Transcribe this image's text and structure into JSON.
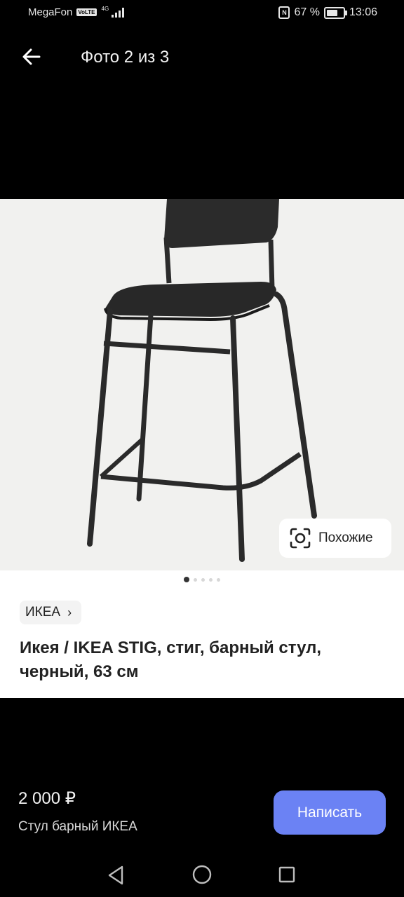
{
  "status_bar": {
    "carrier": "MegaFon",
    "volte": "VoLTE",
    "network": "4G",
    "battery_percent": "67 %",
    "time": "13:06",
    "battery_level": 0.67
  },
  "header": {
    "photo_counter": "Фото 2 из 3",
    "back_icon": "arrow-left-icon"
  },
  "gallery": {
    "similar_label": "Похожие",
    "similar_icon": "scan-icon",
    "dots_count": 5,
    "active_index": 0
  },
  "listing": {
    "brand": "ИКЕА",
    "title": "Икея / IKEA STIG, стиг, барный стул, черный, 63 см",
    "price": "2 000 ₽",
    "subtitle": "Стул барный ИКЕА",
    "write_label": "Написать"
  },
  "colors": {
    "accent": "#6b82f4",
    "background": "#000000",
    "sheet": "#ffffff"
  }
}
